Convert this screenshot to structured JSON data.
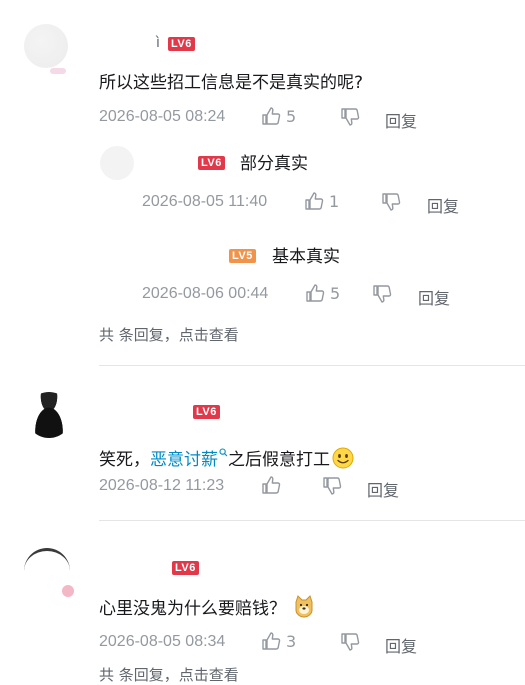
{
  "comments": [
    {
      "level": "LV6",
      "content": "所以这些招工信息是不是真实的呢?",
      "time": "2026-08-05 08:24",
      "likes": "5",
      "reply_label": "回复",
      "replies": [
        {
          "level": "LV6",
          "content": "部分真实",
          "time": "2026-08-05 11:40",
          "likes": "1",
          "reply_label": "回复"
        },
        {
          "level": "LV5",
          "content": "基本真实",
          "time": "2026-08-06 00:44",
          "likes": "5",
          "reply_label": "回复"
        }
      ],
      "summary": "共  条回复，点击查看"
    },
    {
      "level": "LV6",
      "content_prefix": "笑死，",
      "content_link": "恶意讨薪",
      "content_suffix": "之后假意打工",
      "time": "2026-08-12 11:23",
      "likes": "",
      "reply_label": "回复"
    },
    {
      "level": "LV6",
      "content": "心里没鬼为什么要赔钱？",
      "time": "2026-08-05 08:34",
      "likes": "3",
      "reply_label": "回复",
      "summary": "共  条回复，点击查看"
    }
  ],
  "colors": {
    "level_red": "#e2394a",
    "level_orange": "#f2934a",
    "link": "#008ac5"
  },
  "icons": [
    "like-icon",
    "dislike-icon",
    "search-link-icon",
    "smile-emoji-icon",
    "doge-emoji-icon"
  ]
}
